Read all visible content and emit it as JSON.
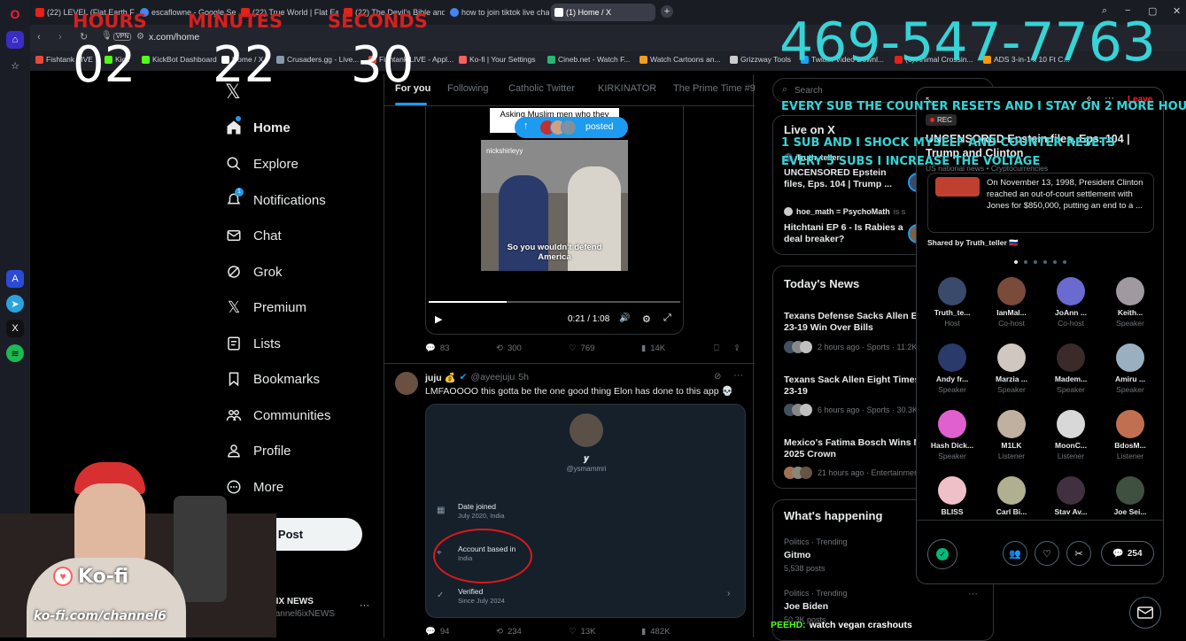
{
  "browser": {
    "tabs": [
      {
        "label": "(22) LEVEL (Flat Earth Film",
        "color": "#e62117"
      },
      {
        "label": "escaflowne - Google Sea",
        "color": "#4285f4"
      },
      {
        "label": "(22) True World | Flat Earth",
        "color": "#e62117"
      },
      {
        "label": "(22) The Devil's Bible and",
        "color": "#e62117"
      },
      {
        "label": "how to join tiktok live cha",
        "color": "#4285f4"
      },
      {
        "label": "(1) Home / X",
        "color": "#ffffff"
      }
    ],
    "new_tab": "+",
    "vpn_badge": "VPN",
    "url": "x.com/home",
    "bookmarks": [
      {
        "label": "Fishtank LIVE",
        "color": "#e64a3c"
      },
      {
        "label": "Kick",
        "color": "#53fc18"
      },
      {
        "label": "KickBot Dashboard",
        "color": "#53fc18"
      },
      {
        "label": "Home / X",
        "color": "#ffffff"
      },
      {
        "label": "Crusaders.gg - Live...",
        "color": "#8899aa"
      },
      {
        "label": "Fishtank LIVE - Appl...",
        "color": "#e64a3c"
      },
      {
        "label": "Ko-fi | Your Settings",
        "color": "#ff5e5b"
      },
      {
        "label": "Cineb.net - Watch F...",
        "color": "#2bb673"
      },
      {
        "label": "Watch Cartoons an...",
        "color": "#f0a020"
      },
      {
        "label": "Grizzway Tools",
        "color": "#cccccc"
      },
      {
        "label": "Twitter Video Downl...",
        "color": "#1da1f2"
      },
      {
        "label": "(6) Animal Crossin...",
        "color": "#e62117"
      },
      {
        "label": "ADS 3-in-1 x 10 Ft C...",
        "color": "#ff9900"
      }
    ]
  },
  "overlay": {
    "hours_label": "HOURS",
    "minutes_label": "MINUTES",
    "seconds_label": "SECONDS",
    "hours": "02",
    "minutes": "22",
    "seconds": "30",
    "phone": "469-547-7763",
    "rules": [
      "EVERY SUB THE COUNTER RESETS AND I STAY ON 2 MORE HOURS",
      "1 SUB AND I SHOCK MYSELF AND COUNTER RESETS",
      "EVERY 5 SUBS I INCREASE THE VOLTAGE"
    ],
    "kofi_label": "Ko-fi",
    "kofi_url": "ko-fi.com/channel6",
    "chat_user": "PEEHD:",
    "chat_msg": "watch vegan crashouts"
  },
  "nav": {
    "items": [
      {
        "label": "Home",
        "icon": "home-icon"
      },
      {
        "label": "Explore",
        "icon": "search-icon"
      },
      {
        "label": "Notifications",
        "icon": "bell-icon",
        "badge": "1"
      },
      {
        "label": "Chat",
        "icon": "mail-icon"
      },
      {
        "label": "Grok",
        "icon": "grok-icon"
      },
      {
        "label": "Premium",
        "icon": "x-premium-icon"
      },
      {
        "label": "Lists",
        "icon": "list-icon"
      },
      {
        "label": "Bookmarks",
        "icon": "bookmark-icon"
      },
      {
        "label": "Communities",
        "icon": "people-icon"
      },
      {
        "label": "Profile",
        "icon": "user-icon"
      },
      {
        "label": "More",
        "icon": "more-circle-icon"
      }
    ],
    "post_label": "Post",
    "account_name": "IRL6IX NEWS",
    "account_handle": "@channel6ixNEWS"
  },
  "timeline": {
    "tabs": [
      "For you",
      "Following",
      "Catholic Twitter",
      "KIRKINATOR",
      "The Prime Time #9"
    ],
    "posted_pill": "posted",
    "video": {
      "caption_top": "Asking Muslim men who they",
      "watermark": "nickshirleyy",
      "subtitle": "So you wouldn't defend America",
      "time": "0:21 / 1:08"
    },
    "post1_stats": {
      "replies": "83",
      "reposts": "300",
      "likes": "769",
      "views": "14K"
    },
    "post2": {
      "name": "juju 💰",
      "handle": "@ayeejuju",
      "time": "5h",
      "text": "LMFAOOOO this gotta be the one good thing Elon has done to this app 💀",
      "card_name": "𝒚",
      "card_handle": "@ysmammri",
      "date_joined_label": "Date joined",
      "date_joined_value": "July 2020, India",
      "based_label": "Account based in",
      "based_value": "India",
      "verified_label": "Verified",
      "verified_value": "Since July 2024",
      "stats": {
        "replies": "94",
        "reposts": "234",
        "likes": "13K",
        "views": "482K"
      }
    }
  },
  "right": {
    "search_placeholder": "Search",
    "live_title": "Live on X",
    "live_items": [
      {
        "host": "Truth_teller",
        "title": "UNCENSORED Epstein files, Eps. 104 | Trump ..."
      },
      {
        "host": "hoe_math = PsychoMath",
        "extra": "is s",
        "title": "Hitchtani EP 6 - Is Rabies a deal breaker?"
      }
    ],
    "news_title": "Today's News",
    "news": [
      {
        "title": "Texans Defense Sacks Allen Ei 23-19 Win Over Bills",
        "meta": "2 hours ago · Sports · 11.2K"
      },
      {
        "title": "Texans Sack Allen Eight Times 23-19",
        "meta": "6 hours ago · Sports · 30.3K"
      },
      {
        "title": "Mexico's Fatima Bosch Wins M 2025 Crown",
        "meta": "21 hours ago · Entertainment"
      }
    ],
    "happening_title": "What's happening",
    "trends": [
      {
        "cat": "Politics · Trending",
        "name": "Gitmo",
        "posts": "5,538 posts"
      },
      {
        "cat": "Politics · Trending",
        "name": "Joe Biden",
        "posts": "50.3K posts"
      }
    ]
  },
  "space": {
    "leave": "Leave",
    "rec": "REC",
    "title": "UNCENSORED Epstein files, Eps. 104 | Trump and Clinton",
    "topics": "US national news • Cryptocurrencies",
    "pinned_text": "On November 13, 1998, President Clinton reached an out-of-court settlement with Jones for $850,000, putting an end to a ...",
    "shared_by": "Shared by Truth_teller 🇷🇺",
    "participants": [
      {
        "name": "Truth_te...",
        "role": "Host",
        "color": "#3a4a6a"
      },
      {
        "name": "IanMal...",
        "role": "Co-host",
        "color": "#7a4a3a"
      },
      {
        "name": "JoAnn ...",
        "role": "Co-host",
        "color": "#6a6ad0"
      },
      {
        "name": "Keith...",
        "role": "Speaker",
        "color": "#a09aa0"
      },
      {
        "name": "Andy fr...",
        "role": "Speaker",
        "color": "#2a3a6a"
      },
      {
        "name": "Marzia ...",
        "role": "Speaker",
        "color": "#d0c8c0"
      },
      {
        "name": "Madem...",
        "role": "Speaker",
        "color": "#3a2a2a"
      },
      {
        "name": "Amiru ...",
        "role": "Speaker",
        "color": "#9ab0c0"
      },
      {
        "name": "Hash Dick...",
        "role": "Speaker",
        "color": "#e060d0"
      },
      {
        "name": "M1LK",
        "role": "Listener",
        "color": "#c0b0a0"
      },
      {
        "name": "MoonC...",
        "role": "Listener",
        "color": "#d8d8d8"
      },
      {
        "name": "BdosM...",
        "role": "Listener",
        "color": "#c07050"
      },
      {
        "name": "BLISS",
        "role": "",
        "color": "#f0c0c8"
      },
      {
        "name": "Carl Bi...",
        "role": "",
        "color": "#b0b090"
      },
      {
        "name": "Stay Av...",
        "role": "",
        "color": "#403040"
      },
      {
        "name": "Joe Sei...",
        "role": "",
        "color": "#405040"
      }
    ],
    "reply_count": "254"
  }
}
